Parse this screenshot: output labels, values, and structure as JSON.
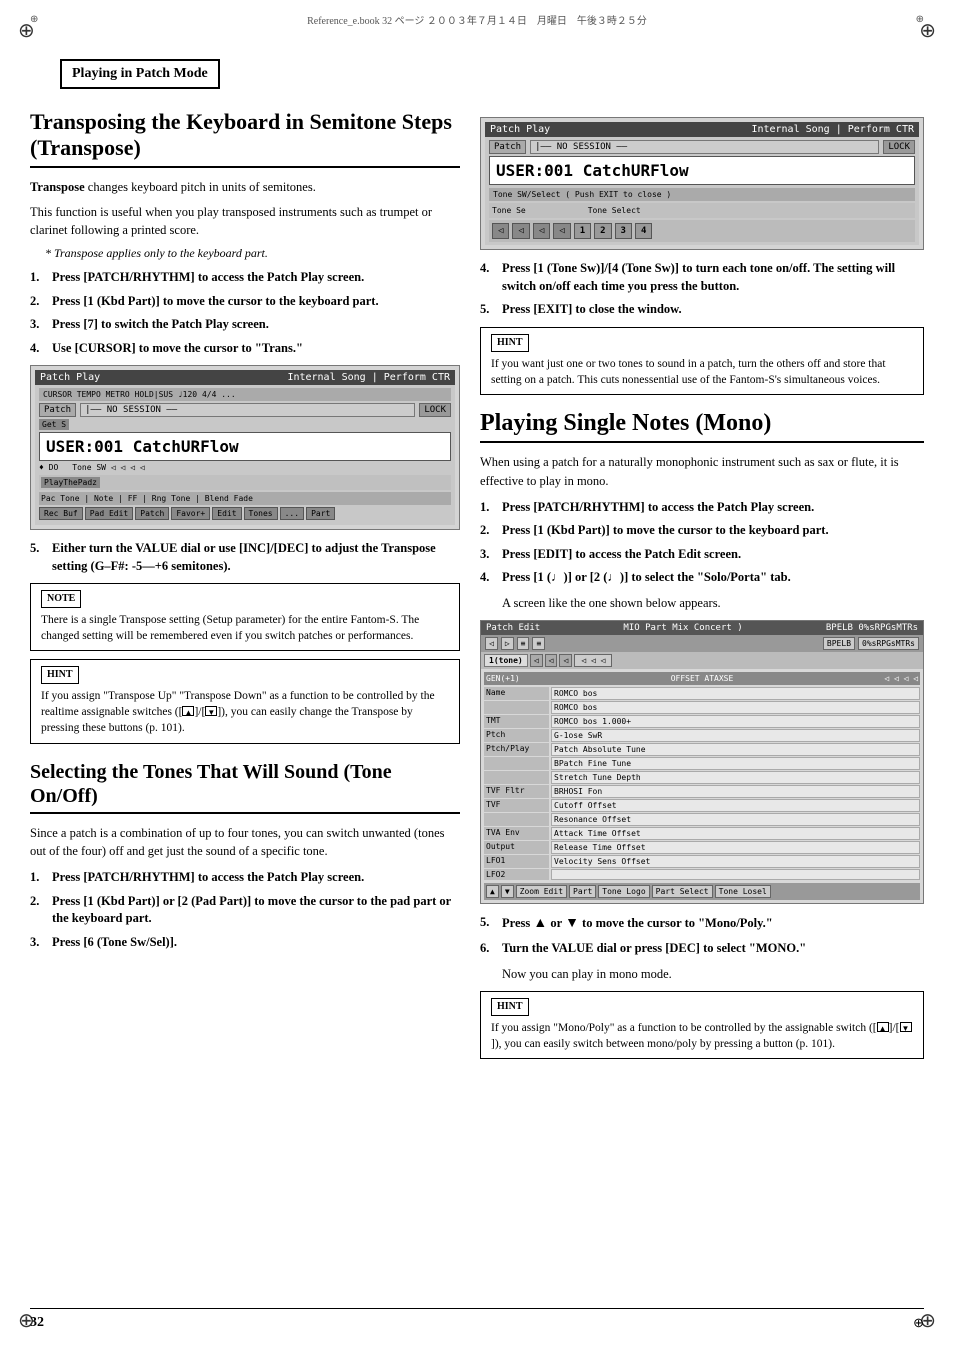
{
  "page": {
    "number": "32",
    "file_info": "Reference_e.book  32 ページ  ２００３年７月１４日　月曜日　午後３時２５分"
  },
  "section_header": "Playing in Patch Mode",
  "left_col": {
    "section1": {
      "title": "Transposing the Keyboard in Semitone Steps (Transpose)",
      "intro_bold": "Transpose",
      "intro_text": " changes keyboard pitch in units of semitones.",
      "body1": "This function is useful when you play transposed instruments such as trumpet or clarinet following a printed score.",
      "italic_note": "* Transpose applies only to the keyboard part.",
      "steps": [
        {
          "num": "1.",
          "text": "Press [PATCH/RHYTHM] to access the Patch Play screen."
        },
        {
          "num": "2.",
          "text": "Press [1 (Kbd Part)] to move the cursor to the keyboard part."
        },
        {
          "num": "3.",
          "text": "Press [7] to switch the Patch Play screen."
        },
        {
          "num": "4.",
          "text": "Use [CURSOR] to move the cursor to \"Trans.\""
        }
      ],
      "screen1": {
        "title": "Patch Play",
        "title_right": "Internal  Song   |  Perform  CTR",
        "row1": "CURSOR  TEMPO  METRO  HOLD|SUSTAIN  #120  4/4  ...",
        "patch_label": "Patch",
        "lock_label": "LOCK",
        "user_text": "USER:001 CatchURFlow",
        "sub_row": "Get  S",
        "tone_label": "Tone SW",
        "playing_text": "PlayThePadz",
        "bottom": "Pac Tone  Note  FF  Rng Tone  Blend Fade"
      },
      "step5": "Either turn the VALUE dial or use [INC]/[DEC] to adjust the Transpose setting (G–F#: -5—+6 semitones).",
      "note_box": {
        "label": "NOTE",
        "text": "There is a single Transpose setting (Setup parameter) for the entire Fantom-S. The changed setting will be remembered even if you switch patches or performances."
      },
      "hint_box": {
        "label": "HINT",
        "text": "If you assign \"Transpose Up\" \"Transpose Down\" as a function to be controlled by the realtime assignable switches ([  ]/[  ]), you can easily change the Transpose by pressing these buttons (p. 101)."
      }
    },
    "section2": {
      "title": "Selecting the Tones That Will Sound (Tone On/Off)",
      "body1": "Since a patch is a combination of up to four tones, you can switch unwanted (tones out of the four) off and get just the sound of a specific tone.",
      "steps": [
        {
          "num": "1.",
          "text": "Press [PATCH/RHYTHM] to access the Patch Play screen."
        },
        {
          "num": "2.",
          "text": "Press [1 (Kbd Part)] or [2 (Pad Part)] to move the cursor to the pad part or the keyboard part."
        },
        {
          "num": "3.",
          "text": "Press [6 (Tone Sw/Sel)]."
        }
      ]
    }
  },
  "right_col": {
    "screen2": {
      "title": "Patch Play",
      "title_right": "Internal  Song  |  Perform  CTR",
      "patch_label": "Patch",
      "lock_label": "LOCK",
      "user_text": "USER:001 CatchURFlow",
      "tone_sw_label": "Tone SW/Select  ( Push EXIT to close )",
      "tone_se": "Tone Se",
      "tone_select": "Tone Select",
      "buttons": [
        "◁",
        "◁",
        "◁",
        "◁",
        "1",
        "2",
        "3",
        "4"
      ]
    },
    "steps_after_screen2": [
      {
        "num": "4.",
        "text": "Press [1 (Tone Sw)]/[4 (Tone Sw)] to turn each tone on/off. The setting will switch on/off each time you press the button."
      },
      {
        "num": "5.",
        "text": "Press [EXIT] to close the window."
      }
    ],
    "hint_box2": {
      "label": "HINT",
      "text": "If you want just one or two tones to sound in a patch, turn the others off and store that setting on a patch. This cuts nonessential use of the Fantom-S's simultaneous voices."
    },
    "section3": {
      "title": "Playing Single Notes (Mono)",
      "body1": "When using a patch for a naturally monophonic instrument such as sax or flute, it is effective to play in mono.",
      "steps": [
        {
          "num": "1.",
          "text": "Press [PATCH/RHYTHM] to access the Patch Play screen."
        },
        {
          "num": "2.",
          "text": "Press [1 (Kbd Part)] to move the cursor to the keyboard part."
        },
        {
          "num": "3.",
          "text": "Press [EDIT] to access the Patch Edit screen."
        },
        {
          "num": "4.",
          "text": "Press [1 (♩)] or [2 (♩)] to select the \"Solo/Porta\" tab."
        },
        {
          "num": "sub",
          "text": "A screen like the one shown below appears."
        }
      ],
      "patch_edit_screen": {
        "title": "Patch Edit",
        "title_mid": "MIO Part  Mix Concert  )",
        "title_right": "BPELB  0%sRPGsMTRs",
        "toolbar_btns": [
          "◁",
          "▷",
          "≡",
          "≡",
          "BPELB",
          "0%sRPGsMTRs"
        ],
        "tabs": [
          "1(tone)",
          "◁",
          "◁",
          "◁",
          "◁",
          "◁"
        ],
        "rows": [
          {
            "group": "GEN(+1)",
            "label": "OFFSET ATAXSE",
            "value": ""
          },
          {
            "label": "Name",
            "value": "ROMCO bos"
          },
          {
            "label": "",
            "value": "ROMCO bos"
          },
          {
            "label": "TMT",
            "value": "ROMCO bos         1.000 +"
          },
          {
            "label": "Ptch",
            "value": "G-1ose  SwR"
          },
          {
            "label": "Ptch/Play",
            "value": "Patch Absolute Tune"
          },
          {
            "label": "",
            "value": "BPatch  Fine Tune"
          },
          {
            "label": "",
            "value": "Stretch Tune Depth"
          },
          {
            "label": "TVF Fltr",
            "value": "BRHOSI Fon"
          },
          {
            "label": "TVF",
            "value": "Cutoff Offset"
          },
          {
            "label": "",
            "value": "Resonance Offset"
          },
          {
            "label": "TVA Env",
            "value": "Attack Time Offset"
          },
          {
            "label": "Output",
            "value": "Release Time Offset"
          },
          {
            "label": "LFO1",
            "value": "Velocity Sens Offset"
          },
          {
            "label": "LFO2",
            "value": ""
          }
        ],
        "bottom_btns": [
          "▲",
          "▼",
          "Zoom Edit",
          "Part",
          "Tone Logo",
          "Part Select",
          "Tone Losel"
        ]
      },
      "steps_after_screen": [
        {
          "num": "5.",
          "text": "Press ▲ or ▼  to move the cursor to \"Mono/Poly.\""
        },
        {
          "num": "6.",
          "text": "Turn the VALUE dial or press [DEC] to select \"MONO.\""
        },
        {
          "num": "sub",
          "text": "Now you can play in mono mode."
        }
      ],
      "hint_box3": {
        "label": "HINT",
        "text": "If you assign \"Mono/Poly\" as a function to be controlled by the assignable switch ([  ]/[  ]), you can easily switch between mono/poly by pressing a button (p. 101)."
      }
    }
  }
}
